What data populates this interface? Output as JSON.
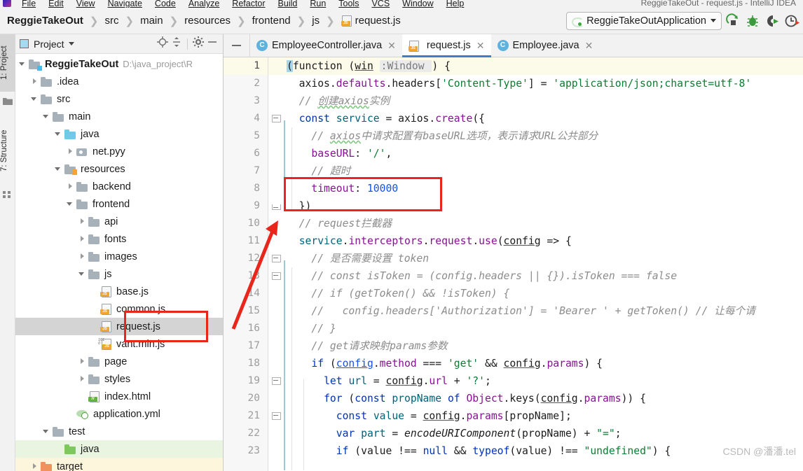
{
  "menu": {
    "items": [
      "File",
      "Edit",
      "View",
      "Navigate",
      "Code",
      "Analyze",
      "Refactor",
      "Build",
      "Run",
      "Tools",
      "VCS",
      "Window",
      "Help"
    ],
    "window_title": "ReggieTakeOut - request.js - IntelliJ IDEA"
  },
  "breadcrumb": {
    "items": [
      {
        "label": "ReggieTakeOut",
        "icon": ""
      },
      {
        "label": "src",
        "icon": ""
      },
      {
        "label": "main",
        "icon": ""
      },
      {
        "label": "resources",
        "icon": ""
      },
      {
        "label": "frontend",
        "icon": ""
      },
      {
        "label": "js",
        "icon": ""
      },
      {
        "label": "request.js",
        "icon": "js-file-icon"
      }
    ]
  },
  "toolbar": {
    "run_config": "ReggieTakeOutApplication",
    "icons": [
      "run-icon",
      "debug-icon",
      "run-with-coverage-icon",
      "profiler-icon"
    ]
  },
  "left_strip": {
    "tabs": [
      {
        "label": "1: Project",
        "selected": true,
        "icon": "project-folder-icon"
      },
      {
        "label": "7: Structure",
        "selected": false,
        "icon": "structure-icon"
      }
    ]
  },
  "project_panel": {
    "title": "Project",
    "toolbar_icons": [
      "locate-icon",
      "collapse-all-icon",
      "gear-icon",
      "hide-icon"
    ],
    "tree": [
      {
        "label": "ReggieTakeOut",
        "path": "D:\\java_project\\R",
        "indent": 0,
        "arrow": "open",
        "icon": "module-folder-icon",
        "bold": true,
        "state": "none"
      },
      {
        "label": ".idea",
        "path": "",
        "indent": 1,
        "arrow": "closed",
        "icon": "folder-icon",
        "bold": false,
        "state": "none"
      },
      {
        "label": "src",
        "path": "",
        "indent": 1,
        "arrow": "open",
        "icon": "folder-icon",
        "bold": false,
        "state": "none"
      },
      {
        "label": "main",
        "path": "",
        "indent": 2,
        "arrow": "open",
        "icon": "folder-icon",
        "bold": false,
        "state": "none"
      },
      {
        "label": "java",
        "path": "",
        "indent": 3,
        "arrow": "open",
        "icon": "source-folder-icon",
        "bold": false,
        "state": "none"
      },
      {
        "label": "net.pyy",
        "path": "",
        "indent": 4,
        "arrow": "closed",
        "icon": "package-icon",
        "bold": false,
        "state": "none"
      },
      {
        "label": "resources",
        "path": "",
        "indent": 3,
        "arrow": "open",
        "icon": "resources-folder-icon",
        "bold": false,
        "state": "none"
      },
      {
        "label": "backend",
        "path": "",
        "indent": 4,
        "arrow": "closed",
        "icon": "folder-icon",
        "bold": false,
        "state": "none"
      },
      {
        "label": "frontend",
        "path": "",
        "indent": 4,
        "arrow": "open",
        "icon": "folder-icon",
        "bold": false,
        "state": "none"
      },
      {
        "label": "api",
        "path": "",
        "indent": 5,
        "arrow": "closed",
        "icon": "folder-icon",
        "bold": false,
        "state": "none"
      },
      {
        "label": "fonts",
        "path": "",
        "indent": 5,
        "arrow": "closed",
        "icon": "folder-icon",
        "bold": false,
        "state": "none"
      },
      {
        "label": "images",
        "path": "",
        "indent": 5,
        "arrow": "closed",
        "icon": "folder-icon",
        "bold": false,
        "state": "none"
      },
      {
        "label": "js",
        "path": "",
        "indent": 5,
        "arrow": "open",
        "icon": "folder-icon",
        "bold": false,
        "state": "none"
      },
      {
        "label": "base.js",
        "path": "",
        "indent": 6,
        "arrow": "none",
        "icon": "js-file-icon",
        "bold": false,
        "state": "none"
      },
      {
        "label": "common.js",
        "path": "",
        "indent": 6,
        "arrow": "none",
        "icon": "js-file-icon",
        "bold": false,
        "state": "none"
      },
      {
        "label": "request.js",
        "path": "",
        "indent": 6,
        "arrow": "none",
        "icon": "js-file-icon",
        "bold": false,
        "state": "selected"
      },
      {
        "label": "vant.min.js",
        "path": "",
        "indent": 6,
        "arrow": "none",
        "icon": "min-js-file-icon",
        "bold": false,
        "state": "none"
      },
      {
        "label": "page",
        "path": "",
        "indent": 5,
        "arrow": "closed",
        "icon": "folder-icon",
        "bold": false,
        "state": "none"
      },
      {
        "label": "styles",
        "path": "",
        "indent": 5,
        "arrow": "closed",
        "icon": "folder-icon",
        "bold": false,
        "state": "none"
      },
      {
        "label": "index.html",
        "path": "",
        "indent": 5,
        "arrow": "none",
        "icon": "html-file-icon",
        "bold": false,
        "state": "none"
      },
      {
        "label": "application.yml",
        "path": "",
        "indent": 4,
        "arrow": "none",
        "icon": "spring-yml-icon",
        "bold": false,
        "state": "none"
      },
      {
        "label": "test",
        "path": "",
        "indent": 2,
        "arrow": "open",
        "icon": "folder-icon",
        "bold": false,
        "state": "none"
      },
      {
        "label": "java",
        "path": "",
        "indent": 3,
        "arrow": "none",
        "icon": "test-source-folder-icon",
        "bold": false,
        "state": "green"
      },
      {
        "label": "target",
        "path": "",
        "indent": 1,
        "arrow": "closed",
        "icon": "excluded-folder-icon",
        "bold": false,
        "state": "yellow"
      }
    ]
  },
  "editor": {
    "tabs": [
      {
        "label": "EmployeeController.java",
        "icon": "java-class-icon",
        "active": false
      },
      {
        "label": "request.js",
        "icon": "js-file-icon",
        "active": true
      },
      {
        "label": "Employee.java",
        "icon": "java-class-icon",
        "active": false
      }
    ],
    "first_line": 1,
    "lines": [
      {
        "n": 1,
        "text": "(function (win :Window ) {"
      },
      {
        "n": 2,
        "text": "  axios.defaults.headers['Content-Type'] = 'application/json;charset=utf-8'"
      },
      {
        "n": 3,
        "text": "  // 创建axios实例"
      },
      {
        "n": 4,
        "text": "  const service = axios.create({"
      },
      {
        "n": 5,
        "text": "    // axios中请求配置有baseURL选项，表示请求URL公共部分"
      },
      {
        "n": 6,
        "text": "    baseURL: '/',"
      },
      {
        "n": 7,
        "text": "    // 超时"
      },
      {
        "n": 8,
        "text": "    timeout: 10000"
      },
      {
        "n": 9,
        "text": "  })"
      },
      {
        "n": 10,
        "text": "  // request拦截器"
      },
      {
        "n": 11,
        "text": "  service.interceptors.request.use(config => {"
      },
      {
        "n": 12,
        "text": "    // 是否需要设置 token"
      },
      {
        "n": 13,
        "text": "    // const isToken = (config.headers || {}).isToken === false"
      },
      {
        "n": 14,
        "text": "    // if (getToken() && !isToken) {"
      },
      {
        "n": 15,
        "text": "    //   config.headers['Authorization'] = 'Bearer ' + getToken() // 让每个请"
      },
      {
        "n": 16,
        "text": "    // }"
      },
      {
        "n": 17,
        "text": "    // get请求映射params参数"
      },
      {
        "n": 18,
        "text": "    if (config.method === 'get' && config.params) {"
      },
      {
        "n": 19,
        "text": "      let url = config.url + '?';"
      },
      {
        "n": 20,
        "text": "      for (const propName of Object.keys(config.params)) {"
      },
      {
        "n": 21,
        "text": "        const value = config.params[propName];"
      },
      {
        "n": 22,
        "text": "        var part = encodeURIComponent(propName) + \"=\";"
      },
      {
        "n": 23,
        "text": "        if (value !== null && typeof(value) !== \"undefined\") {"
      }
    ]
  },
  "annotations": {
    "box_color": "#e8261b",
    "arrow_color": "#e8261b",
    "highlight_timeout_line": 8,
    "highlight_tree_item": "request.js"
  },
  "watermark": "CSDN @潘潘.tel"
}
